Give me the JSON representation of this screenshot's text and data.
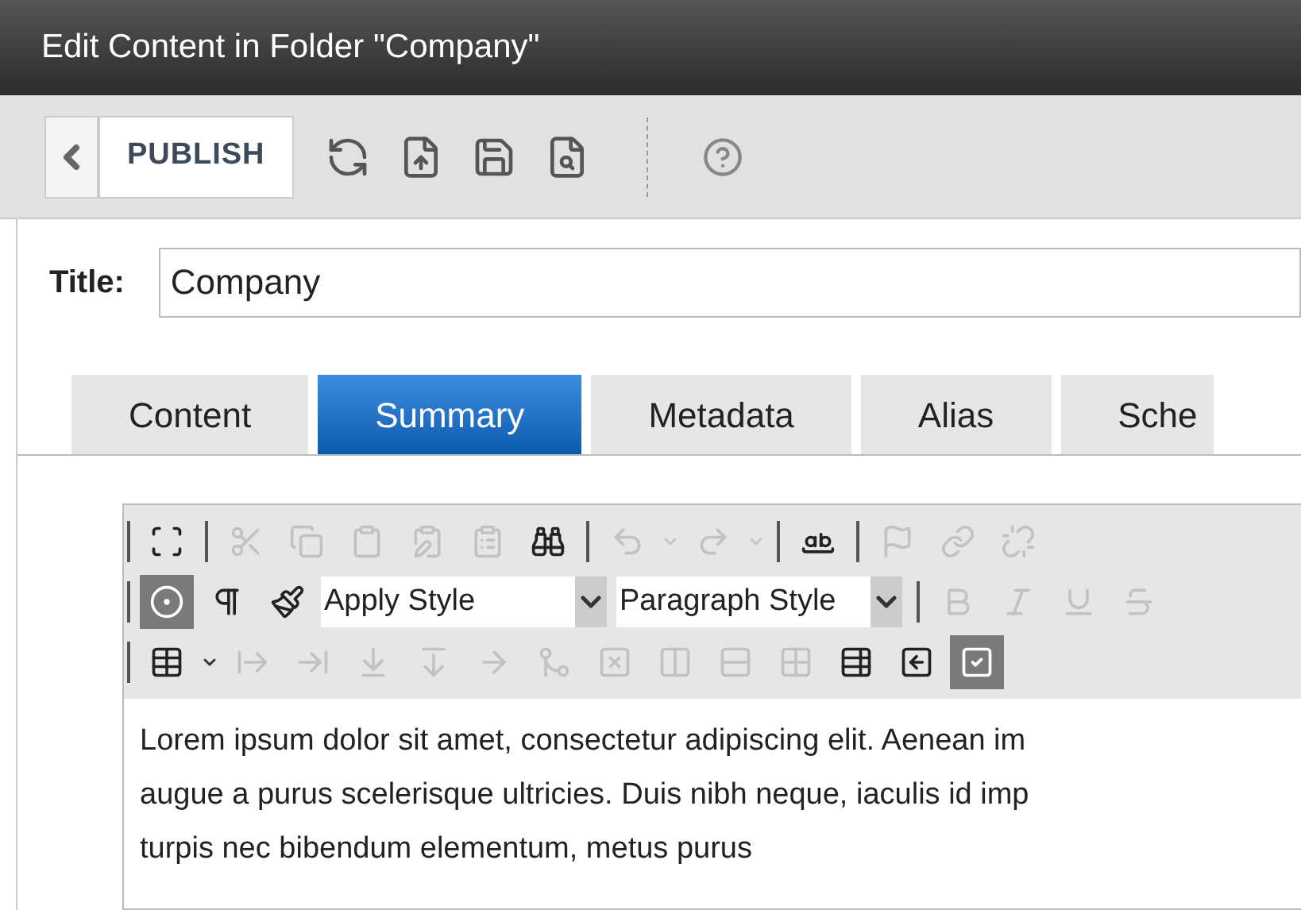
{
  "window": {
    "title": "Edit Content in Folder \"Company\""
  },
  "toolbar": {
    "publish": "PUBLISH"
  },
  "title_field": {
    "label": "Title:",
    "value": "Company"
  },
  "tabs": [
    {
      "label": "Content",
      "selected": false
    },
    {
      "label": "Summary",
      "selected": true
    },
    {
      "label": "Metadata",
      "selected": false
    },
    {
      "label": "Alias",
      "selected": false
    },
    {
      "label": "Sche",
      "selected": false
    }
  ],
  "editor_toolbar": [
    [
      {
        "kind": "button",
        "disabled": false,
        "pressed": false
      },
      {
        "kind": "separator"
      },
      {
        "kind": "button",
        "disabled": true,
        "pressed": false
      },
      {
        "kind": "button",
        "disabled": true,
        "pressed": false
      },
      {
        "kind": "button",
        "disabled": true,
        "pressed": false
      },
      {
        "kind": "button",
        "disabled": true,
        "pressed": false
      },
      {
        "kind": "button",
        "disabled": true,
        "pressed": false
      },
      {
        "kind": "button",
        "disabled": false,
        "pressed": false
      },
      {
        "kind": "separator"
      },
      {
        "kind": "button",
        "disabled": true,
        "pressed": false
      },
      {
        "kind": "caret",
        "disabled": true
      },
      {
        "kind": "button",
        "disabled": true,
        "pressed": false
      },
      {
        "kind": "caret",
        "disabled": true
      },
      {
        "kind": "separator"
      },
      {
        "kind": "button",
        "disabled": false,
        "pressed": false
      },
      {
        "kind": "separator"
      },
      {
        "kind": "button",
        "disabled": true,
        "pressed": false
      },
      {
        "kind": "button",
        "disabled": true,
        "pressed": false
      },
      {
        "kind": "button",
        "disabled": true,
        "pressed": false
      }
    ],
    [
      {
        "kind": "button",
        "disabled": false,
        "pressed": true
      },
      {
        "kind": "button",
        "disabled": false,
        "pressed": false
      },
      {
        "kind": "button",
        "disabled": false,
        "pressed": false
      },
      {
        "kind": "select",
        "value": "Apply Style"
      },
      {
        "kind": "select",
        "value": "Paragraph Style"
      },
      {
        "kind": "separator"
      },
      {
        "kind": "button",
        "disabled": true,
        "pressed": false
      },
      {
        "kind": "button",
        "disabled": true,
        "pressed": false
      },
      {
        "kind": "button",
        "disabled": true,
        "pressed": false
      },
      {
        "kind": "button",
        "disabled": true,
        "pressed": false
      }
    ],
    [
      {
        "kind": "button",
        "disabled": false,
        "pressed": false
      },
      {
        "kind": "caret",
        "disabled": false
      },
      {
        "kind": "button",
        "disabled": true,
        "pressed": false
      },
      {
        "kind": "button",
        "disabled": true,
        "pressed": false
      },
      {
        "kind": "button",
        "disabled": true,
        "pressed": false
      },
      {
        "kind": "button",
        "disabled": true,
        "pressed": false
      },
      {
        "kind": "button",
        "disabled": true,
        "pressed": false
      },
      {
        "kind": "button",
        "disabled": true,
        "pressed": false
      },
      {
        "kind": "button",
        "disabled": true,
        "pressed": false
      },
      {
        "kind": "button",
        "disabled": true,
        "pressed": false
      },
      {
        "kind": "button",
        "disabled": true,
        "pressed": false
      },
      {
        "kind": "button",
        "disabled": true,
        "pressed": false
      },
      {
        "kind": "button",
        "disabled": false,
        "pressed": false
      },
      {
        "kind": "button",
        "disabled": false,
        "pressed": false
      },
      {
        "kind": "button",
        "disabled": false,
        "pressed": true
      }
    ]
  ],
  "editor_text": [
    "Lorem ipsum dolor sit amet, consectetur adipiscing elit. Aenean im",
    "augue a purus scelerisque ultricies. Duis nibh neque, iaculis id imp",
    "turpis nec bibendum elementum, metus purus"
  ]
}
